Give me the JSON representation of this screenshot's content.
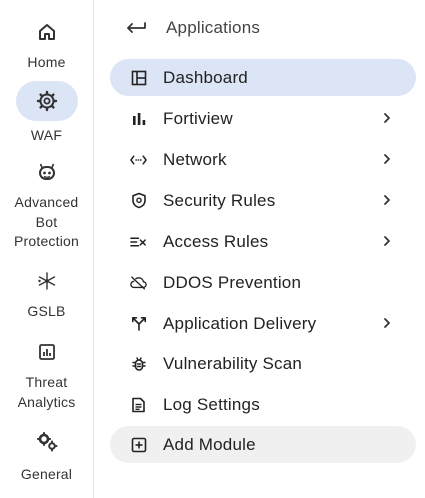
{
  "rail": {
    "items": [
      {
        "lines": [
          "Home"
        ],
        "icon": "home-icon"
      },
      {
        "lines": [
          "WAF"
        ],
        "icon": "gear-icon",
        "active": true
      },
      {
        "lines": [
          "Advanced",
          "Bot",
          "Protection"
        ],
        "icon": "bot-icon"
      },
      {
        "lines": [
          "GSLB"
        ],
        "icon": "globe-network-icon"
      },
      {
        "lines": [
          "Threat",
          "Analytics"
        ],
        "icon": "analytics-icon"
      },
      {
        "lines": [
          "General"
        ],
        "icon": "gears-icon"
      }
    ]
  },
  "panel": {
    "back_title": "Applications",
    "items": [
      {
        "label": "Dashboard",
        "icon": "dashboard-icon",
        "active": true,
        "chevron": false
      },
      {
        "label": "Fortiview",
        "icon": "bar-chart-icon",
        "chevron": true
      },
      {
        "label": "Network",
        "icon": "network-icon",
        "chevron": true
      },
      {
        "label": "Security Rules",
        "icon": "shield-icon",
        "chevron": true
      },
      {
        "label": "Access Rules",
        "icon": "access-rules-icon",
        "chevron": true
      },
      {
        "label": "DDOS Prevention",
        "icon": "cloud-off-icon",
        "chevron": false
      },
      {
        "label": "Application Delivery",
        "icon": "delivery-icon",
        "chevron": true
      },
      {
        "label": "Vulnerability Scan",
        "icon": "bug-icon",
        "chevron": false
      },
      {
        "label": "Log Settings",
        "icon": "document-icon",
        "chevron": false
      },
      {
        "label": "Add Module",
        "icon": "add-box-icon",
        "chevron": false
      }
    ]
  }
}
